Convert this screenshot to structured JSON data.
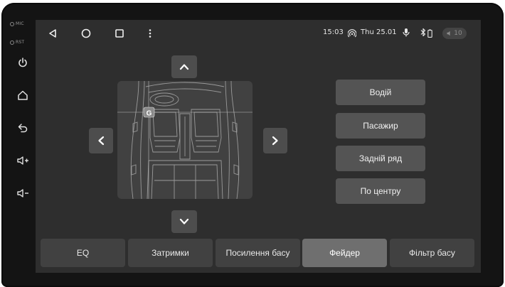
{
  "device": {
    "mic_label": "MIC",
    "rst_label": "RST",
    "side_buttons": [
      "power-icon",
      "home-icon",
      "back-icon",
      "volume-up-icon",
      "volume-down-icon"
    ]
  },
  "statusbar": {
    "time": "15:03",
    "date": "Thu 25.01",
    "volume": "10",
    "icons": [
      "hotspot-icon",
      "microphone-icon",
      "bluetooth-icon",
      "battery-icon",
      "speaker-icon"
    ]
  },
  "navbar": {
    "icons": [
      "back-triangle-icon",
      "home-circle-icon",
      "recents-square-icon",
      "menu-dots-icon"
    ]
  },
  "fader": {
    "logo_letter": "G",
    "arrows": [
      "up",
      "down",
      "left",
      "right"
    ]
  },
  "positions": {
    "items": [
      {
        "label": "Водій"
      },
      {
        "label": "Пасажир"
      },
      {
        "label": "Задній ряд"
      },
      {
        "label": "По центру"
      }
    ]
  },
  "tabs": {
    "items": [
      {
        "label": "EQ",
        "active": false
      },
      {
        "label": "Затримки",
        "active": false
      },
      {
        "label": "Посилення басу",
        "active": false
      },
      {
        "label": "Фейдер",
        "active": true
      },
      {
        "label": "Фільтр басу",
        "active": false
      }
    ]
  },
  "colors": {
    "screen_bg": "#2e2e2e",
    "bezel": "#141414",
    "button_bg": "#545454",
    "tab_bg": "#414141",
    "tab_active_bg": "#6f6f6f",
    "text": "#f0f0f0"
  }
}
